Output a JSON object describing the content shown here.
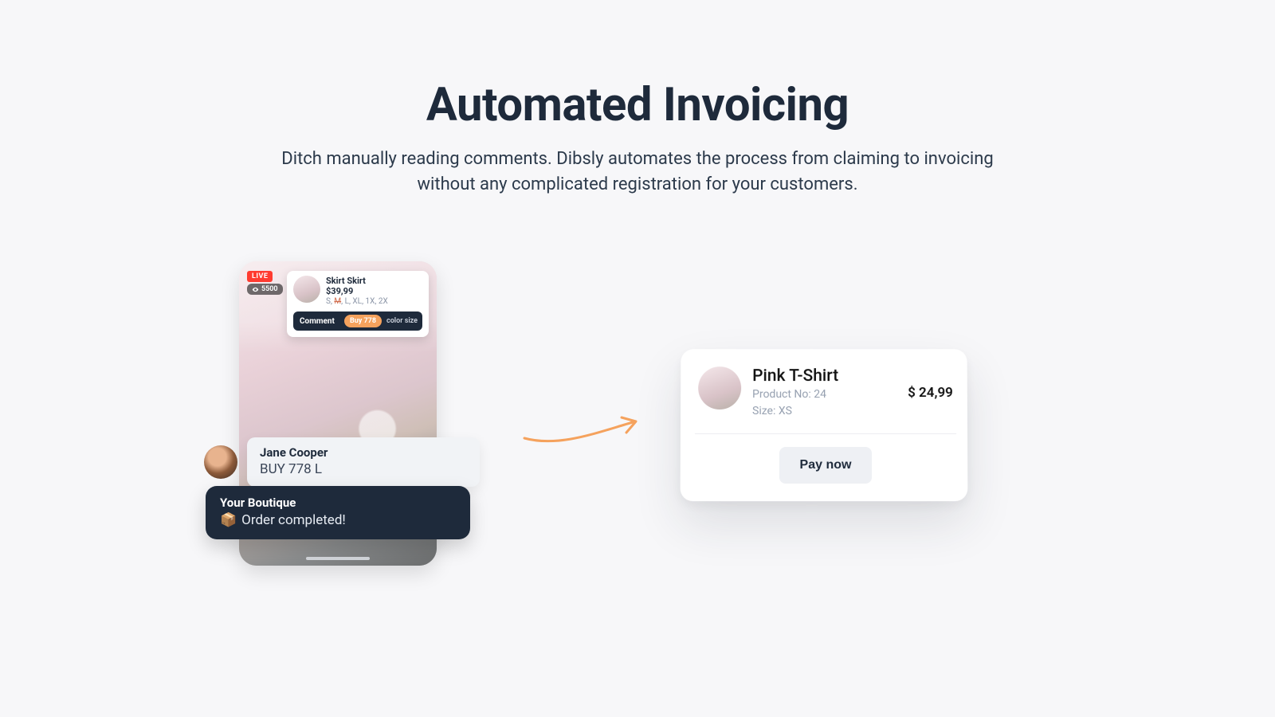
{
  "hero": {
    "title": "Automated Invoicing",
    "subtitle": "Ditch manually reading comments. Dibsly automates the process from claiming to invoicing without any complicated registration for your customers."
  },
  "live": {
    "badge": "LIVE",
    "viewers": "5500"
  },
  "product_card": {
    "title": "Skirt Skirt",
    "price": "$39,99",
    "sizes_prefix": "S, ",
    "sizes_struck": "M",
    "sizes_suffix": ", L, XL, 1X, 2X",
    "comment_label": "Comment",
    "buy_pill": "Buy 778",
    "hint": "color size"
  },
  "comment": {
    "name": "Jane Cooper",
    "message": "BUY 778 L"
  },
  "merchant": {
    "name": "Your Boutique",
    "emoji": "📦",
    "message": "Order completed!"
  },
  "invoice": {
    "title": "Pink T-Shirt",
    "product_no": "Product No: 24",
    "size": "Size: XS",
    "price": "$ 24,99",
    "pay_button": "Pay now"
  }
}
